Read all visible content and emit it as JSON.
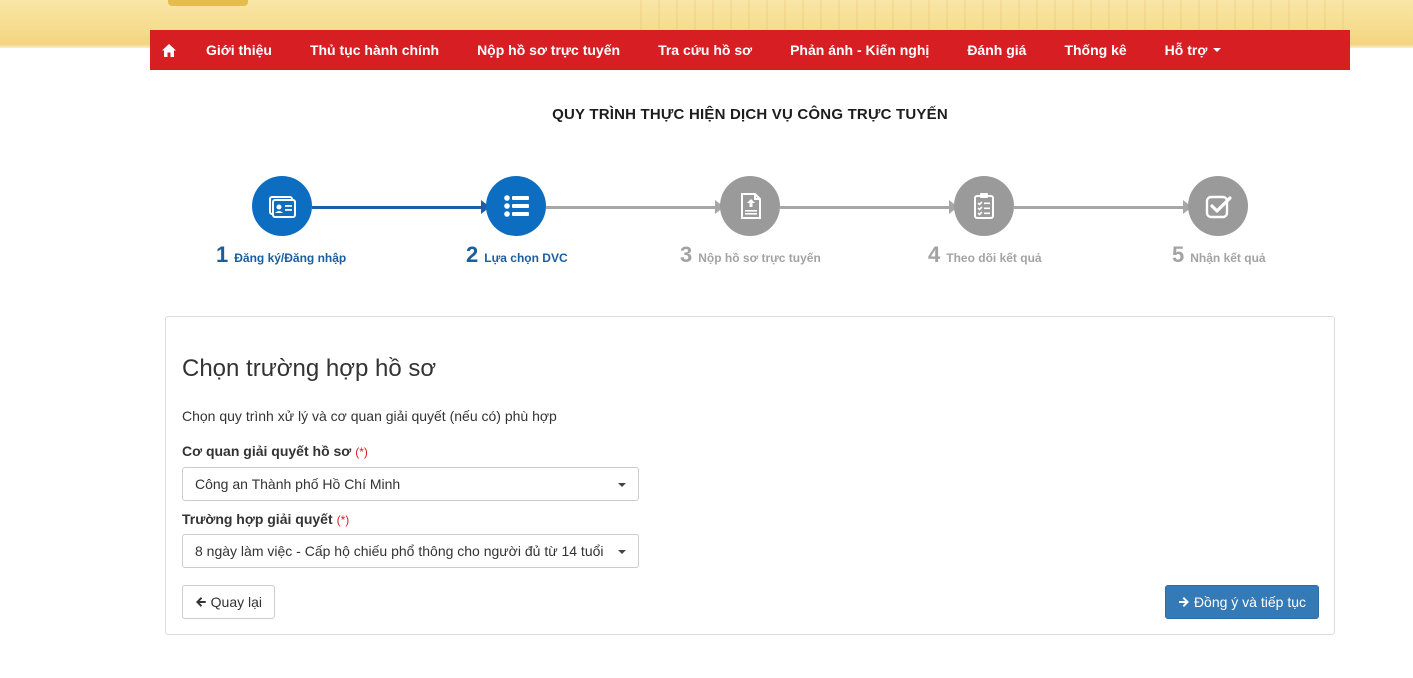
{
  "nav": {
    "items": [
      {
        "label": "Giới thiệu"
      },
      {
        "label": "Thủ tục hành chính"
      },
      {
        "label": "Nộp hồ sơ trực tuyến"
      },
      {
        "label": "Tra cứu hồ sơ"
      },
      {
        "label": "Phản ánh - Kiến nghị"
      },
      {
        "label": "Đánh giá"
      },
      {
        "label": "Thống kê"
      },
      {
        "label": "Hỗ trợ"
      }
    ]
  },
  "process": {
    "title": "QUY TRÌNH THỰC HIỆN DỊCH VỤ CÔNG TRỰC TUYẾN",
    "steps": [
      {
        "num": "1",
        "label": "Đăng ký/Đăng nhập",
        "state": "active"
      },
      {
        "num": "2",
        "label": "Lựa chọn DVC",
        "state": "active"
      },
      {
        "num": "3",
        "label": "Nộp hồ sơ trực tuyến",
        "state": "inactive"
      },
      {
        "num": "4",
        "label": "Theo dõi kết quả",
        "state": "inactive"
      },
      {
        "num": "5",
        "label": "Nhận kết quả",
        "state": "inactive"
      }
    ]
  },
  "form": {
    "title": "Chọn trường hợp hồ sơ",
    "description": "Chọn quy trình xử lý và cơ quan giải quyết (nếu có) phù hợp",
    "agency": {
      "label": "Cơ quan giải quyết hồ sơ",
      "required_mark": "(*)",
      "value": "Công an Thành phố Hồ Chí Minh"
    },
    "case": {
      "label": "Trường hợp giải quyết",
      "required_mark": "(*)",
      "value": "8 ngày làm việc - Cấp hộ chiếu phổ thông cho người đủ từ 14 tuổi"
    },
    "back_label": "Quay lại",
    "next_label": "Đồng ý và tiếp tục"
  },
  "colors": {
    "nav_red": "#d71e22",
    "step_active": "#0d6ec1",
    "step_inactive": "#9a9a9a",
    "primary_button": "#337ab7"
  }
}
